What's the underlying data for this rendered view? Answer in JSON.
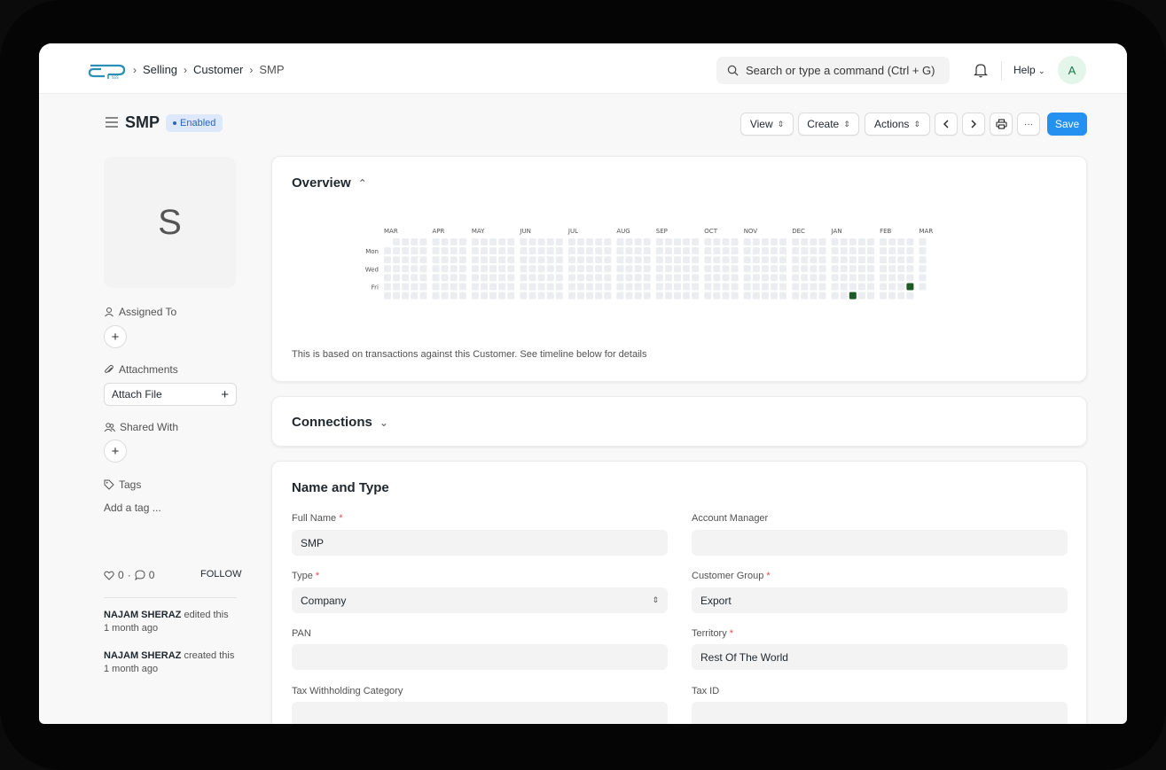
{
  "breadcrumb": [
    "Selling",
    "Customer",
    "SMP"
  ],
  "search": {
    "placeholder": "Search or type a command (Ctrl + G)"
  },
  "header": {
    "help_label": "Help",
    "avatar_initial": "A"
  },
  "doc": {
    "title": "SMP",
    "status": "Enabled",
    "status_color": "#2b64bd"
  },
  "actions": {
    "view": "View",
    "create": "Create",
    "actions": "Actions",
    "more": "···",
    "save": "Save",
    "save_color": "#2490ef"
  },
  "sidebar": {
    "image_initial": "S",
    "assigned_to": "Assigned To",
    "attachments": "Attachments",
    "attach_file": "Attach File",
    "shared_with": "Shared With",
    "tags": "Tags",
    "add_tag": "Add a tag ...",
    "likes": "0",
    "comments": "0",
    "follow": "FOLLOW",
    "activity": [
      {
        "user": "NAJAM SHERAZ",
        "action": "edited this",
        "time": "1 month ago"
      },
      {
        "user": "NAJAM SHERAZ",
        "action": "created this",
        "time": "1 month ago"
      }
    ]
  },
  "overview": {
    "title": "Overview",
    "months": [
      "MAR",
      "APR",
      "MAY",
      "JUN",
      "JUL",
      "AUG",
      "SEP",
      "OCT",
      "NOV",
      "DEC",
      "JAN",
      "FEB",
      "MAR"
    ],
    "days": [
      "Mon",
      "Wed",
      "Fri"
    ],
    "note": "This is based on transactions against this Customer. See timeline below for details",
    "empty_color": "#ebedf0",
    "active_color": "#1e5a26"
  },
  "connections": {
    "title": "Connections"
  },
  "name_and_type": {
    "title": "Name and Type",
    "fields": {
      "full_name": {
        "label": "Full Name",
        "value": "SMP",
        "required": "*"
      },
      "account_manager": {
        "label": "Account Manager",
        "value": ""
      },
      "type": {
        "label": "Type",
        "value": "Company",
        "required": "*"
      },
      "customer_group": {
        "label": "Customer Group",
        "value": "Export",
        "required": "*"
      },
      "pan": {
        "label": "PAN",
        "value": ""
      },
      "territory": {
        "label": "Territory",
        "value": "Rest Of The World",
        "required": "*"
      },
      "tax_withholding_category": {
        "label": "Tax Withholding Category",
        "value": ""
      },
      "tax_id": {
        "label": "Tax ID",
        "value": ""
      }
    }
  }
}
